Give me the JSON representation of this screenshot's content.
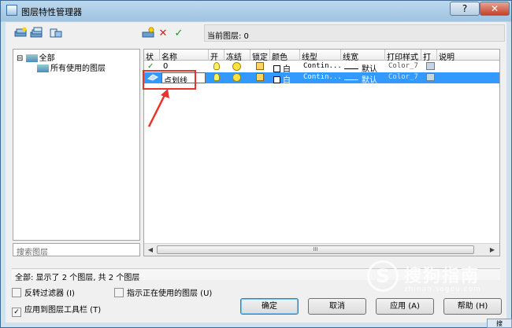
{
  "window": {
    "title": "图层特性管理器",
    "help_btn": "?",
    "close_btn": "✕"
  },
  "toolbar": {
    "current_layer_label": "当前图层: 0",
    "new_icon": "layer-new-icon",
    "delete_icon": "delete-x-icon",
    "set_current_icon": "checkmark-icon"
  },
  "tree": {
    "root": "全部",
    "root_toggle": "⊟",
    "child": "所有使用的图层"
  },
  "search_placeholder": "搜索图层",
  "columns": [
    "状",
    "名称",
    "开",
    "冻结",
    "锁定",
    "颜色",
    "线型",
    "线宽",
    "打印样式",
    "打",
    "说明"
  ],
  "layers": [
    {
      "status": "✓",
      "name": "0",
      "color": "白",
      "linetype": "Contin...",
      "lineweight": "默认",
      "plotstyle": "Color_7",
      "selected": false
    },
    {
      "status": "",
      "name": "点划线",
      "color": "白",
      "linetype": "Contin...",
      "lineweight": "默认",
      "plotstyle": "Color_7",
      "selected": true
    }
  ],
  "scroll_grip": "III",
  "status_text": "全部: 显示了 2 个图层, 共 2 个图层",
  "options": {
    "invert_filter": "反转过滤器 (I)",
    "indicate_in_use": "指示正在使用的图层 (U)",
    "apply_to_toolbar": "应用到图层工具栏 (T)",
    "apply_to_toolbar_checked": true
  },
  "buttons": {
    "ok": "确定",
    "cancel": "取消",
    "apply": "应用 (A)",
    "help": "帮助 (H)"
  },
  "watermark": {
    "glyph": "S",
    "text": "搜狗指南",
    "sub": "zhinan.sogou.com"
  },
  "taskbar_text": "搜",
  "accent": {
    "selection": "#3399ff",
    "highlight_box": "#e8342a"
  }
}
